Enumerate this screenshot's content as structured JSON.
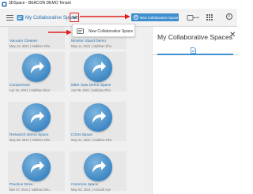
{
  "window": {
    "title": "3DSpace - BEACON DEMO Tenant"
  },
  "topbar": {
    "space_name": "My Collaborative Spaces"
  },
  "toolbar": {
    "new_space_label": "New Collaborative Space"
  },
  "dropdown": {
    "item_label": "New Collaborative Space"
  },
  "side_panel": {
    "title": "My Collaborative Spaces",
    "close_glyph": "✕"
  },
  "colors": {
    "accent": "#3f8fcf",
    "highlight_red": "#e02020",
    "link_blue": "#2a6fa8"
  },
  "tiles": [
    {
      "name": "Vacuum Cleaner",
      "meta": "May 14, 2021 | Vaibhav Dhu"
    },
    {
      "name": "Monitor Stand Demo",
      "meta": "May 11, 2021 | Vaibhav Dhu"
    },
    {
      "name": "Compressor",
      "meta": "Apr 15, 2021 | Vaibhav Dhur"
    },
    {
      "name": "Miter Saw Demo Space",
      "meta": "Apr 09, 2021 | Vaibhav Dhu"
    },
    {
      "name": "Research Demo Space",
      "meta": "May 06, 2021 | Vaibhav Dhu"
    },
    {
      "name": "ICON Space",
      "meta": "May 21, 2021 | Vaibhav Dhu"
    },
    {
      "name": "Practice Drive",
      "meta": "Mar 07, 2021 | Vaibhav Dhu"
    },
    {
      "name": "Common Space",
      "meta": "May 02, 2021 | Anirudh Aye"
    }
  ]
}
